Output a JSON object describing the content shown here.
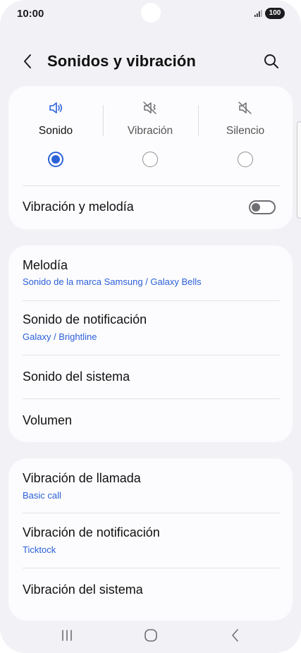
{
  "status_bar": {
    "time": "10:00",
    "battery": "100"
  },
  "header": {
    "title": "Sonidos y vibración"
  },
  "sound_mode": {
    "options": [
      {
        "label": "Sonido",
        "selected": true,
        "icon": "speaker-icon"
      },
      {
        "label": "Vibración",
        "selected": false,
        "icon": "vibrate-icon"
      },
      {
        "label": "Silencio",
        "selected": false,
        "icon": "mute-icon"
      }
    ],
    "vibrate_with_ringtone": {
      "label": "Vibración y melodía",
      "on": false
    }
  },
  "sounds_section": {
    "items": [
      {
        "title": "Melodía",
        "subtitle": "Sonido de la marca Samsung / Galaxy Bells"
      },
      {
        "title": "Sonido de notificación",
        "subtitle": "Galaxy / Brightline"
      },
      {
        "title": "Sonido del sistema"
      },
      {
        "title": "Volumen"
      }
    ]
  },
  "vibration_section": {
    "items": [
      {
        "title": "Vibración de llamada",
        "subtitle": "Basic call"
      },
      {
        "title": "Vibración de notificación",
        "subtitle": "Ticktock"
      },
      {
        "title": "Vibración del sistema"
      }
    ]
  },
  "colors": {
    "accent": "#2c62d8",
    "link": "#2b5fd9",
    "background": "#f2f2f6",
    "card": "#fcfcfe"
  }
}
